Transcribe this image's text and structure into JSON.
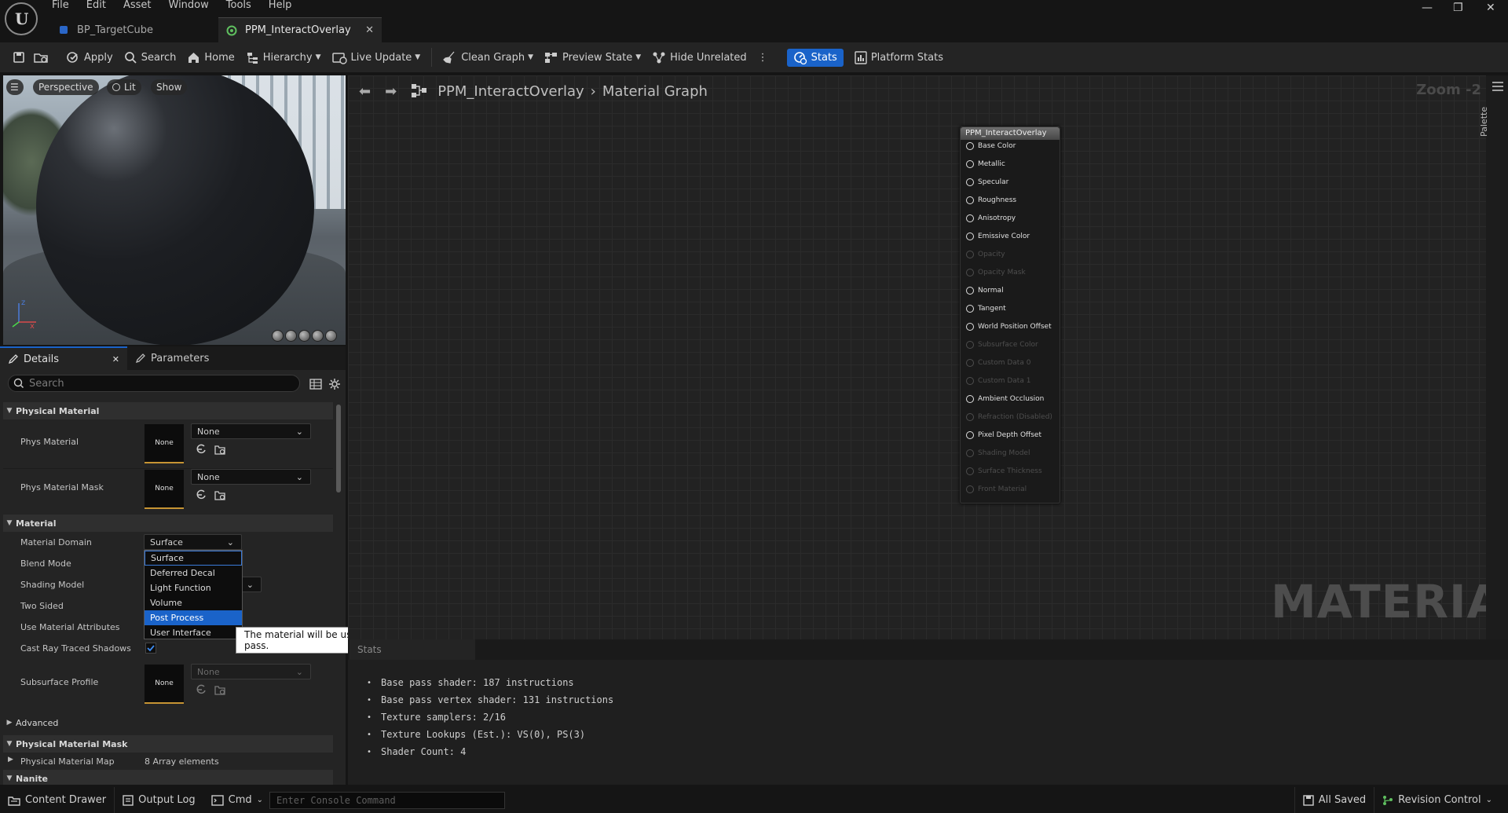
{
  "menu": [
    "File",
    "Edit",
    "Asset",
    "Window",
    "Tools",
    "Help"
  ],
  "tabs": [
    {
      "label": "BP_TargetCube"
    },
    {
      "label": "PPM_InteractOverlay"
    }
  ],
  "toolbar": {
    "apply": "Apply",
    "search": "Search",
    "home": "Home",
    "hierarchy": "Hierarchy",
    "live_update": "Live Update",
    "clean_graph": "Clean Graph",
    "preview_state": "Preview State",
    "hide_unrelated": "Hide Unrelated",
    "stats": "Stats",
    "platform_stats": "Platform Stats"
  },
  "viewport": {
    "perspective": "Perspective",
    "lit": "Lit",
    "show": "Show"
  },
  "details": {
    "tab_details": "Details",
    "tab_parameters": "Parameters",
    "search_placeholder": "Search",
    "categories": {
      "physical_material": "Physical Material",
      "material": "Material",
      "advanced": "Advanced",
      "physical_material_mask": "Physical Material Mask",
      "nanite": "Nanite"
    },
    "props": {
      "phys_material": "Phys Material",
      "phys_material_mask": "Phys Material Mask",
      "material_domain": "Material Domain",
      "blend_mode": "Blend Mode",
      "shading_model": "Shading Model",
      "two_sided": "Two Sided",
      "use_material_attributes": "Use Material Attributes",
      "cast_ray_traced_shadows": "Cast Ray Traced Shadows",
      "subsurface_profile": "Subsurface Profile",
      "physical_material_map": "Physical Material Map"
    },
    "none": "None",
    "material_domain_value": "Surface",
    "physical_material_map_value": "8 Array elements"
  },
  "domain_dropdown": {
    "options": [
      "Surface",
      "Deferred Decal",
      "Light Function",
      "Volume",
      "Post Process",
      "User Interface"
    ],
    "selected": "Post Process",
    "tooltip": "The material will be used in a custom post process pass."
  },
  "graph": {
    "breadcrumb_asset": "PPM_InteractOverlay",
    "breadcrumb_graph": "Material Graph",
    "zoom": "Zoom -2",
    "watermark": "MATERIAL",
    "node_title": "PPM_InteractOverlay",
    "pins": [
      {
        "label": "Base Color",
        "enabled": true
      },
      {
        "label": "Metallic",
        "enabled": true
      },
      {
        "label": "Specular",
        "enabled": true
      },
      {
        "label": "Roughness",
        "enabled": true
      },
      {
        "label": "Anisotropy",
        "enabled": true
      },
      {
        "label": "Emissive Color",
        "enabled": true
      },
      {
        "label": "Opacity",
        "enabled": false
      },
      {
        "label": "Opacity Mask",
        "enabled": false
      },
      {
        "label": "Normal",
        "enabled": true
      },
      {
        "label": "Tangent",
        "enabled": true
      },
      {
        "label": "World Position Offset",
        "enabled": true
      },
      {
        "label": "Subsurface Color",
        "enabled": false
      },
      {
        "label": "Custom Data 0",
        "enabled": false
      },
      {
        "label": "Custom Data 1",
        "enabled": false
      },
      {
        "label": "Ambient Occlusion",
        "enabled": true
      },
      {
        "label": "Refraction (Disabled)",
        "enabled": false
      },
      {
        "label": "Pixel Depth Offset",
        "enabled": true
      },
      {
        "label": "Shading Model",
        "enabled": false
      },
      {
        "label": "Surface Thickness",
        "enabled": false
      },
      {
        "label": "Front Material",
        "enabled": false
      }
    ],
    "palette": "Palette"
  },
  "stats": {
    "tab": "Stats",
    "lines": [
      "Base pass shader: 187 instructions",
      "Base pass vertex shader: 131 instructions",
      "Texture samplers: 2/16",
      "Texture Lookups (Est.): VS(0), PS(3)",
      "Shader Count: 4"
    ]
  },
  "statusbar": {
    "content_drawer": "Content Drawer",
    "output_log": "Output Log",
    "cmd": "Cmd",
    "console_placeholder": "Enter Console Command",
    "all_saved": "All Saved",
    "revision_control": "Revision Control"
  }
}
